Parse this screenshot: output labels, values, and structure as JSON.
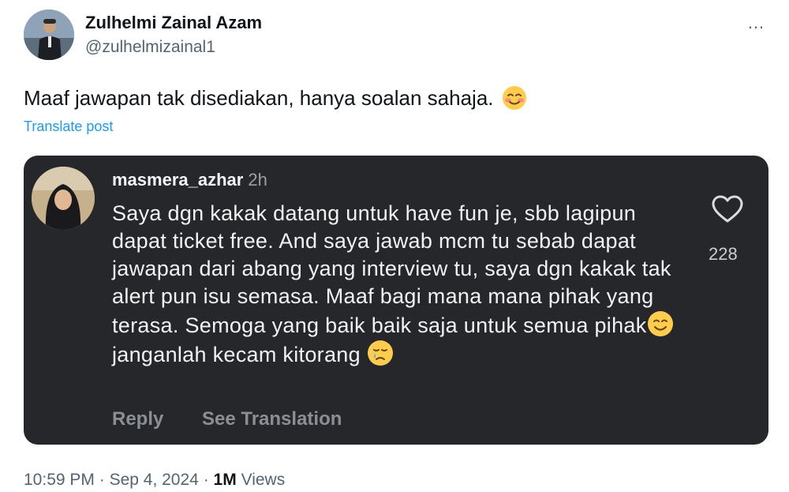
{
  "author": {
    "name": "Zulhelmi Zainal Azam",
    "handle": "@zulhelmizainal1",
    "avatar_icon": "profile-photo"
  },
  "more_icon": "…",
  "tweet": {
    "text": "Maaf jawapan tak disediakan, hanya soalan sahaja.",
    "emoji": "smiling-blushing-face",
    "translate_label": "Translate post"
  },
  "embed": {
    "username": "masmera_azhar",
    "time": "2h",
    "avatar_icon": "profile-photo",
    "body_part1": "Saya dgn kakak datang untuk have fun je, sbb lagipun dapat ticket free. And saya jawab mcm tu sebab dapat jawapan dari abang yang interview tu, saya dgn kakak tak alert pun isu semasa. Maaf bagi mana mana pihak yang terasa. Semoga yang baik baik saja untuk semua pihak",
    "body_part2": " janganlah kecam kitorang ",
    "emoji_1": "smiling-face",
    "emoji_2": "crying-face",
    "like_count": "228",
    "like_icon": "heart-outline",
    "reply_label": "Reply",
    "see_translation_label": "See Translation"
  },
  "meta": {
    "time": "10:59 PM",
    "separator": "·",
    "date": "Sep 4, 2024",
    "views_count": "1M",
    "views_label": "Views"
  },
  "colors": {
    "link": "#1d9bf0",
    "card_background": "#25272b",
    "secondary_text": "#536471"
  }
}
